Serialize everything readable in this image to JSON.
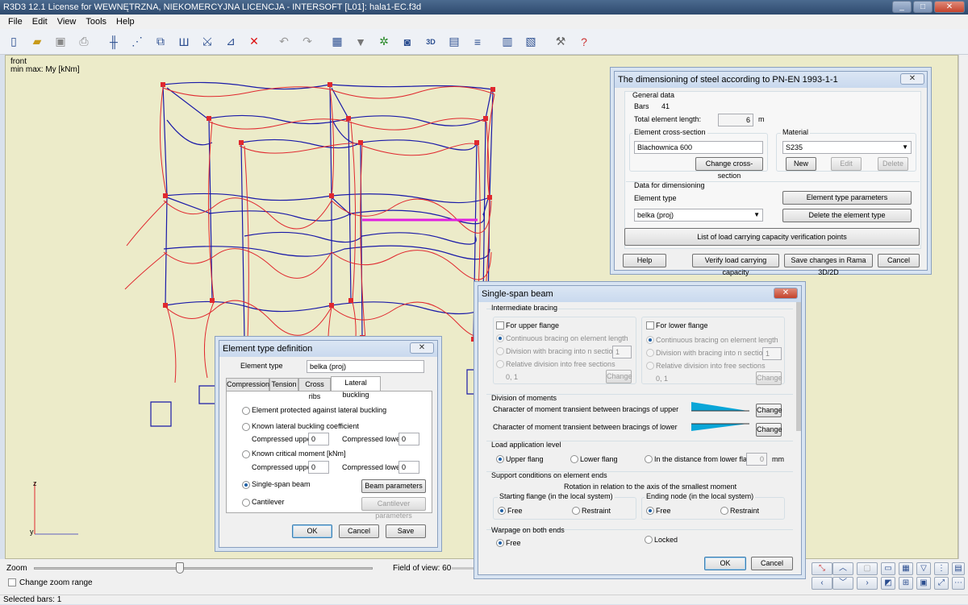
{
  "window": {
    "title": "R3D3 12.1 License for WEWNĘTRZNA, NIEKOMERCYJNA LICENCJA - INTERSOFT [L01]: hala1-EC.f3d",
    "minimize": "_",
    "maximize": "□",
    "close": "✕"
  },
  "menu": [
    "File",
    "Edit",
    "View",
    "Tools",
    "Help"
  ],
  "toolbar_icons": [
    "new-file-icon",
    "open-folder-icon",
    "save-icon",
    "print-icon",
    "frame-icon",
    "nodes-icon",
    "bars-icon",
    "supports-icon",
    "loads-icon",
    "selection-icon",
    "delete-icon",
    "undo-icon",
    "redo-icon",
    "calculate-icon",
    "filter-icon",
    "view-icon",
    "camera-icon",
    "3d-icon",
    "table-icon",
    "results-icon",
    "report-icon",
    "dimensioning-icon",
    "settings-icon",
    "help-icon"
  ],
  "viewport": {
    "view_label": "front",
    "minmax_label": "min max: My [kNm]",
    "axis_z": "z",
    "axis_y": "y"
  },
  "zoom": {
    "label": "Zoom",
    "field_of_view": "Field of view: 60",
    "change_zoom_range": "Change zoom range"
  },
  "status": "Selected bars: 1",
  "steel_dialog": {
    "title": "The dimensioning of steel according to PN-EN 1993-1-1",
    "general_data": "General data",
    "bars_label": "Bars",
    "bars_value": "41",
    "length_label": "Total element length:",
    "length_value": "6",
    "length_unit": "m",
    "cross_section_label": "Element cross-section",
    "cross_section_value": "Blachownica 600",
    "change_cross_section": "Change cross-section",
    "material_label": "Material",
    "material_value": "S235",
    "new": "New",
    "edit": "Edit",
    "delete": "Delete",
    "data_for_dimensioning": "Data for dimensioning",
    "element_type_label": "Element type",
    "element_type_value": "belka (proj)",
    "element_type_parameters": "Element type parameters",
    "delete_element_type": "Delete the element type",
    "list_verification_points": "List of load carrying capacity verification points",
    "help": "Help",
    "verify": "Verify load carrying capacity",
    "save_changes": "Save changes in Rama 3D/2D",
    "cancel": "Cancel"
  },
  "element_type_dialog": {
    "title": "Element type definition",
    "element_type_label": "Element type",
    "element_type_value": "belka (proj)",
    "tabs": [
      "Compression",
      "Tension",
      "Cross ribs",
      "Lateral buckling"
    ],
    "protected": "Element protected against lateral buckling",
    "known_coefficient": "Known lateral buckling coefficient",
    "compressed_upper": "Compressed upper",
    "compressed_lower": "Compressed lower",
    "zero": "0",
    "known_moment": "Known critical moment [kNm]",
    "single_span": "Single-span beam",
    "beam_parameters": "Beam parameters",
    "cantilever": "Cantilever",
    "cantilever_parameters": "Cantilever parameters",
    "ok": "OK",
    "cancel": "Cancel",
    "save": "Save"
  },
  "beam_dialog": {
    "title": "Single-span beam",
    "intermediate_bracing": "Intermediate bracing",
    "upper_flange": "For upper flange",
    "lower_flange": "For lower flange",
    "continuous": "Continuous bracing on element length",
    "division": "Division with bracing into n sections n",
    "n_value": "1",
    "relative": "Relative division into free sections",
    "relative_value": "0, 1",
    "change": "Change",
    "division_of_moments": "Division of moments",
    "moment_upper": "Character of moment transient between bracings of upper",
    "moment_lower": "Character of moment transient between bracings of lower",
    "load_application": "Load application level",
    "upper_flang": "Upper flang",
    "lower_flang": "Lower flang",
    "distance": "In the distance from lower flar",
    "distance_value": "0",
    "distance_unit": "mm",
    "support_conditions": "Support conditions on element ends",
    "rotation": "Rotation in relation to the axis of the smallest moment",
    "starting_flange": "Starting flange (in the local system)",
    "ending_node": "Ending node (in the local system)",
    "free": "Free",
    "restraint": "Restraint",
    "warpage": "Warpage on both ends",
    "locked": "Locked",
    "ok": "OK",
    "cancel": "Cancel"
  },
  "colors": {
    "background": "#ecebc9",
    "frame_blue": "#1a1aa8",
    "frame_red": "#e0282e",
    "accent_magenta": "#e020e0",
    "moment_fill": "#0aa6d8"
  }
}
